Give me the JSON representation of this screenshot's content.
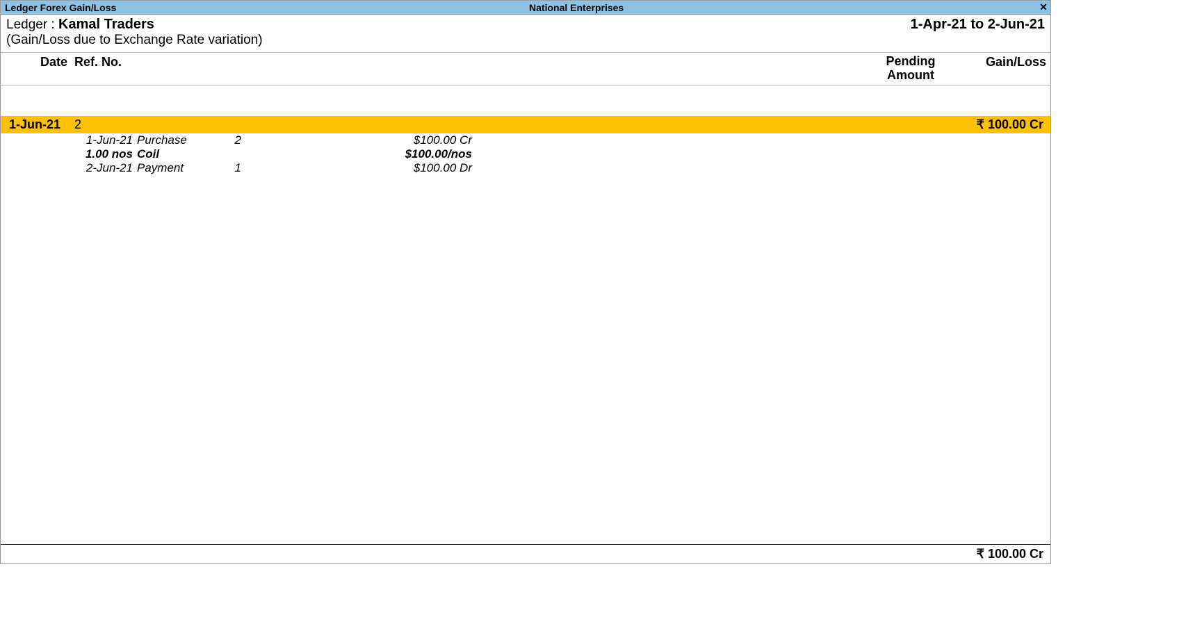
{
  "title_bar": {
    "left": "Ledger Forex Gain/Loss",
    "center": "National Enterprises",
    "close_glyph": "✕"
  },
  "info": {
    "ledger_label": "Ledger :  ",
    "ledger_name": "Kamal Traders",
    "period": "1-Apr-21 to 2-Jun-21",
    "subtitle": "(Gain/Loss due to Exchange Rate variation)"
  },
  "columns": {
    "date": "Date",
    "ref": "Ref. No.",
    "pending_line1": "Pending",
    "pending_line2": "Amount",
    "gain_loss": "Gain/Loss"
  },
  "highlight": {
    "date": "1-Jun-21",
    "ref": "2",
    "amount": "₹ 100.00 Cr"
  },
  "details": [
    {
      "c2": "1-Jun-21",
      "c3": "Purchase",
      "c4": "2",
      "c5": "$100.00 Cr",
      "bold": false
    },
    {
      "c2": "1.00 nos",
      "c3": "Coil",
      "c4": "",
      "c5": "$100.00/nos",
      "bold": true
    },
    {
      "c2": "2-Jun-21",
      "c3": "Payment",
      "c4": "1",
      "c5": "$100.00 Dr",
      "bold": false
    }
  ],
  "footer_total": "₹ 100.00 Cr"
}
